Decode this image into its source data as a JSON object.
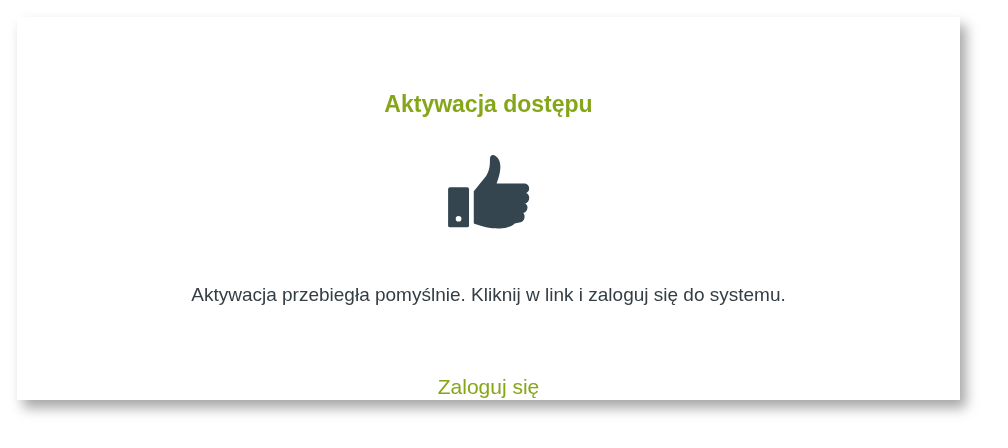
{
  "card": {
    "title": "Aktywacja dostępu",
    "message": "Aktywacja przebiegła pomyślnie. Kliknij w link i zaloguj się do systemu.",
    "link": "Zaloguj się"
  }
}
